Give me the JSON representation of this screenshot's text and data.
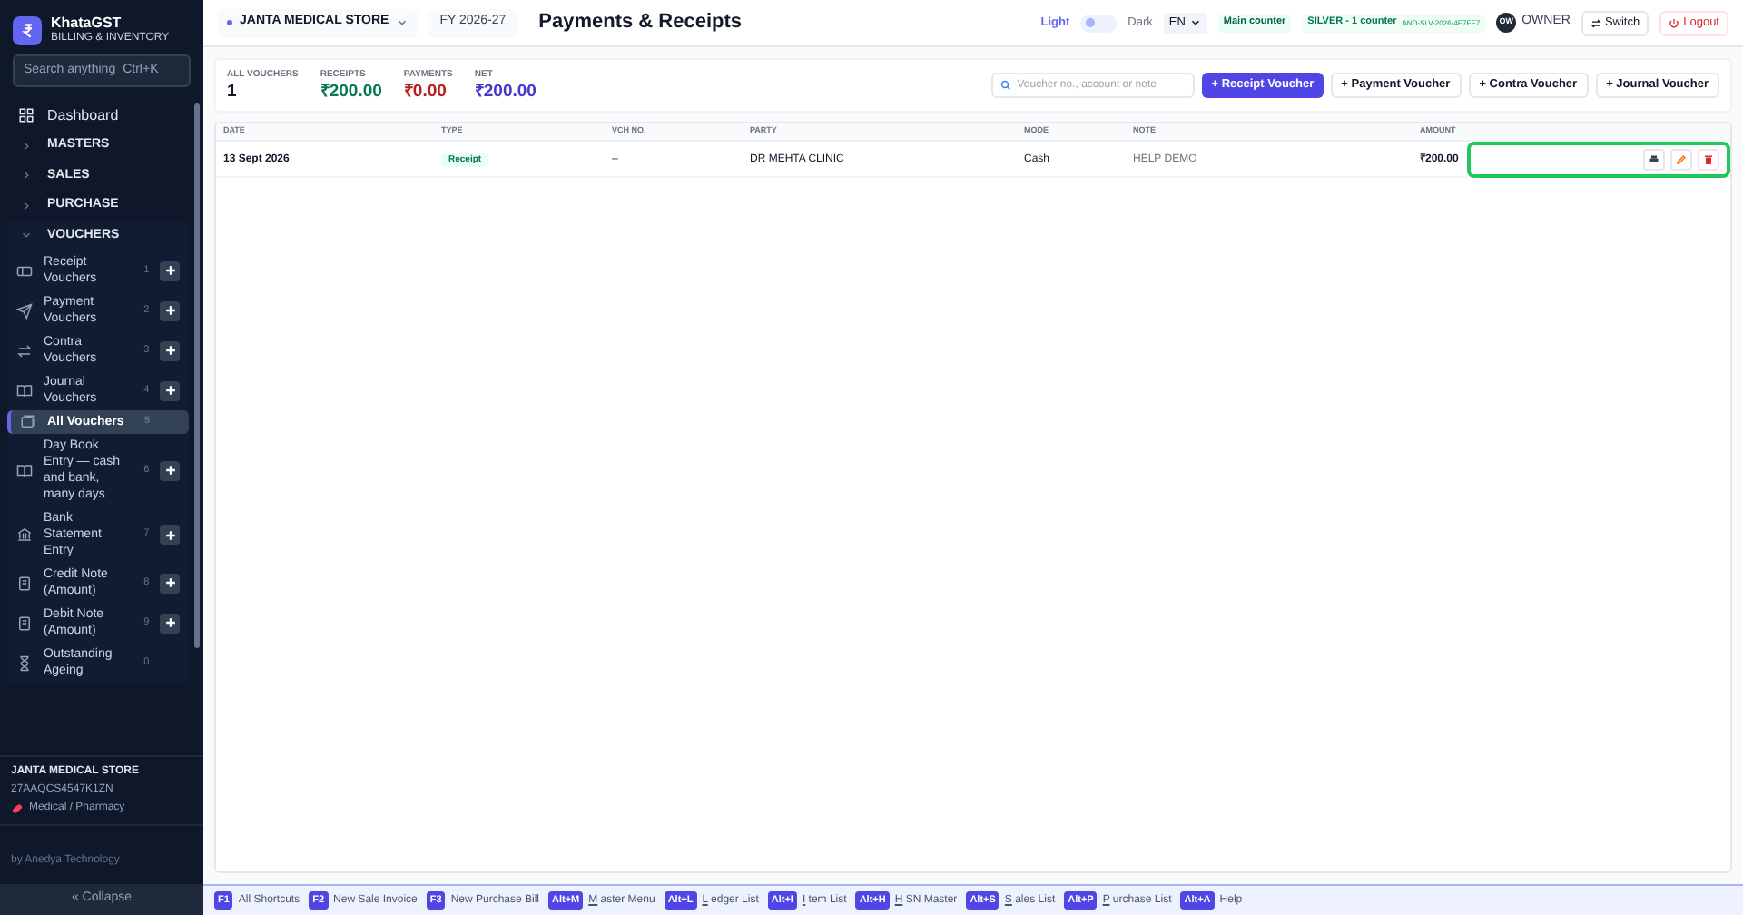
{
  "app": {
    "name": "KhataGST",
    "subtitle": "BILLING & INVENTORY"
  },
  "search": {
    "placeholder": "Search anything",
    "shortcut": "Ctrl+K"
  },
  "sidebar": {
    "items": [
      {
        "kind": "link",
        "label": "Dashboard"
      },
      {
        "kind": "section",
        "label": "MASTERS",
        "expanded": false
      },
      {
        "kind": "section",
        "label": "SALES",
        "expanded": false
      },
      {
        "kind": "section",
        "label": "PURCHASE",
        "expanded": false
      },
      {
        "kind": "section",
        "label": "VOUCHERS",
        "expanded": true,
        "children": [
          {
            "label": "Receipt Vouchers",
            "number": "1",
            "add": true,
            "selected": false
          },
          {
            "label": "Payment Vouchers",
            "number": "2",
            "add": true,
            "selected": false
          },
          {
            "label": "Contra Vouchers",
            "number": "3",
            "add": true,
            "selected": false
          },
          {
            "label": "Journal Vouchers",
            "number": "4",
            "add": true,
            "selected": false
          },
          {
            "label": "All Vouchers",
            "number": "5",
            "add": false,
            "selected": true
          },
          {
            "label": "Day Book Entry — cash and bank, many days",
            "number": "6",
            "add": true,
            "selected": false
          },
          {
            "label": "Bank Statement Entry",
            "number": "7",
            "add": true,
            "selected": false
          },
          {
            "label": "Credit Note (Amount)",
            "number": "8",
            "add": true,
            "selected": false
          },
          {
            "label": "Debit Note (Amount)",
            "number": "9",
            "add": true,
            "selected": false
          },
          {
            "label": "Outstanding Ageing",
            "number": "0",
            "add": false,
            "selected": false
          }
        ]
      }
    ]
  },
  "company": {
    "name": "JANTA MEDICAL STORE",
    "gstin": "27AAQCS4547K1ZN",
    "category": "Medical / Pharmacy"
  },
  "credit": "by Anedya Technology",
  "collapse": "« Collapse",
  "topbar": {
    "store": "JANTA MEDICAL STORE",
    "fy": "FY 2026-27",
    "title": "Payments & Receipts",
    "theme_light": "Light",
    "theme_dark": "Dark",
    "dark_mode": false,
    "language": "EN",
    "counter": "Main counter",
    "plan": "SILVER - 1 counter",
    "license": "AND-SLV-2026-4E7FE7",
    "avatar": "OW",
    "role": "OWNER",
    "switch": "Switch",
    "logout": "Logout"
  },
  "stats": [
    {
      "label": "ALL VOUCHERS",
      "value": "1",
      "color": "#111827"
    },
    {
      "label": "RECEIPTS",
      "value": "₹200.00",
      "color": "#047857"
    },
    {
      "label": "PAYMENTS",
      "value": "₹0.00",
      "color": "#b91c1c"
    },
    {
      "label": "NET",
      "value": "₹200.00",
      "color": "#4338ca"
    }
  ],
  "voucher_search": {
    "placeholder": "Voucher no., account or note"
  },
  "actions": [
    {
      "label": "+ Receipt Voucher",
      "primary": true
    },
    {
      "label": "+ Payment Voucher",
      "primary": false
    },
    {
      "label": "+ Contra Voucher",
      "primary": false
    },
    {
      "label": "+ Journal Voucher",
      "primary": false
    }
  ],
  "table": {
    "columns": [
      "DATE",
      "TYPE",
      "VCH NO.",
      "PARTY",
      "MODE",
      "NOTE",
      "AMOUNT"
    ],
    "rows": [
      {
        "date": "13 Sept 2026",
        "type": "Receipt",
        "vch_no": "–",
        "party": "DR MEHTA CLINIC",
        "mode": "Cash",
        "note": "HELP DEMO",
        "amount": "₹200.00",
        "actions_highlighted": true
      }
    ]
  },
  "shortcuts": [
    {
      "key": "F1",
      "label": "All Shortcuts"
    },
    {
      "key": "F2",
      "label": "New Sale Invoice"
    },
    {
      "key": "F3",
      "label": "New Purchase Bill"
    },
    {
      "key": "Alt+M",
      "hotkey": "M",
      "label": "aster Menu"
    },
    {
      "key": "Alt+L",
      "hotkey": "L",
      "label": "edger List"
    },
    {
      "key": "Alt+I",
      "hotkey": "I",
      "label": "tem List"
    },
    {
      "key": "Alt+H",
      "hotkey": "H",
      "label": "SN Master"
    },
    {
      "key": "Alt+S",
      "hotkey": "S",
      "label": "ales List"
    },
    {
      "key": "Alt+P",
      "hotkey": "P",
      "label": "urchase List"
    },
    {
      "key": "Alt+A",
      "label": "Help"
    }
  ]
}
